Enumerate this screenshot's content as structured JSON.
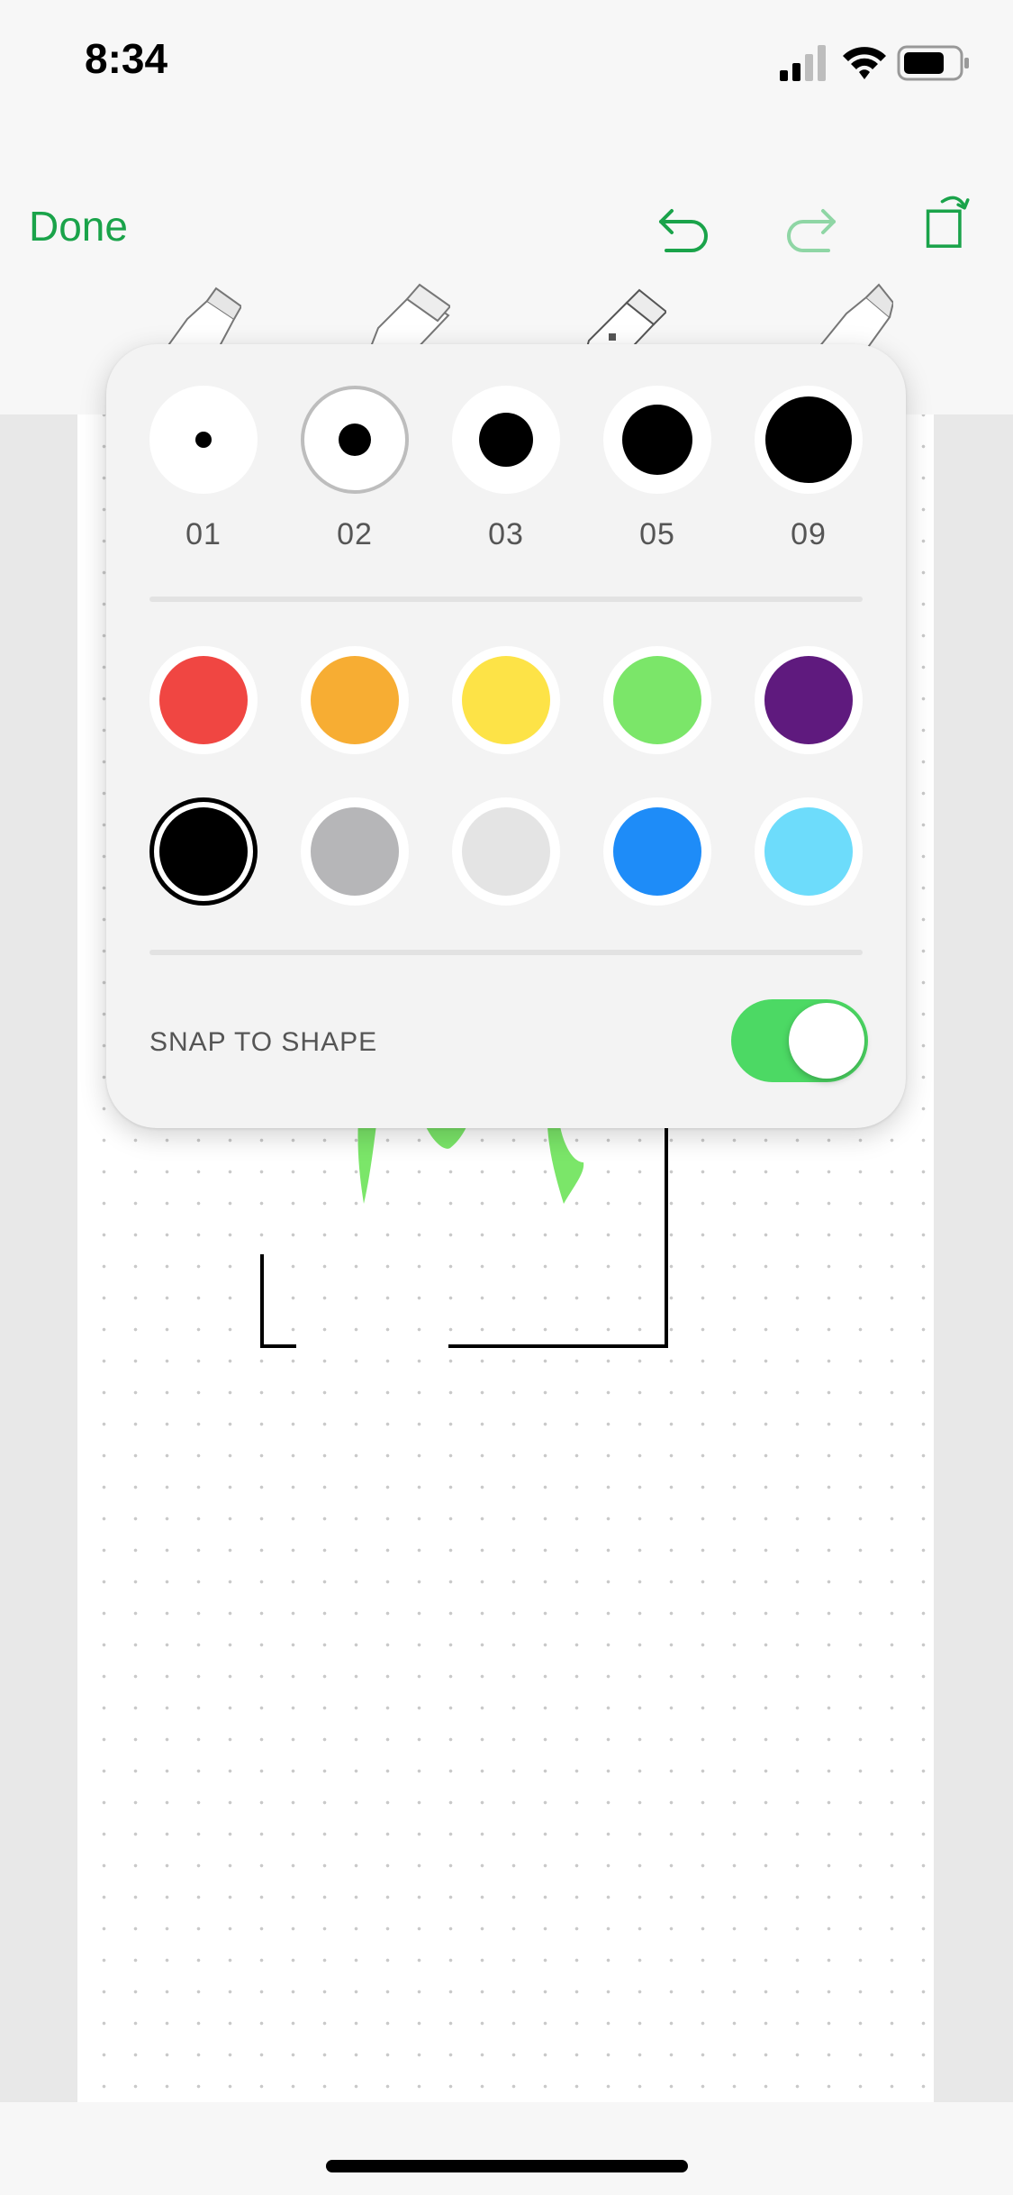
{
  "status_bar": {
    "time": "8:34",
    "icons": [
      "signal-icon",
      "wifi-icon",
      "battery-icon"
    ]
  },
  "toolbar": {
    "done_label": "Done",
    "icons": [
      "undo-icon",
      "redo-icon",
      "rotate-icon"
    ],
    "tools": [
      "pen-tool",
      "marker-tool",
      "highlighter-tool",
      "pencil-tool"
    ]
  },
  "popover": {
    "sizes": [
      {
        "label": "01",
        "selected": false
      },
      {
        "label": "02",
        "selected": true
      },
      {
        "label": "03",
        "selected": false
      },
      {
        "label": "05",
        "selected": false
      },
      {
        "label": "09",
        "selected": false
      }
    ],
    "colors": [
      {
        "name": "red",
        "hex": "#f04642",
        "selected": false
      },
      {
        "name": "orange",
        "hex": "#f7ad33",
        "selected": false
      },
      {
        "name": "yellow",
        "hex": "#fde347",
        "selected": false
      },
      {
        "name": "green",
        "hex": "#7be669",
        "selected": false
      },
      {
        "name": "purple",
        "hex": "#5f1a7e",
        "selected": false
      },
      {
        "name": "black",
        "hex": "#000000",
        "selected": true
      },
      {
        "name": "gray",
        "hex": "#b6b6b8",
        "selected": false
      },
      {
        "name": "light-gray",
        "hex": "#e4e4e4",
        "selected": false
      },
      {
        "name": "blue",
        "hex": "#1e8cf8",
        "selected": false
      },
      {
        "name": "light-blue",
        "hex": "#6ddcfb",
        "selected": false
      }
    ],
    "snap_to_shape_label": "SNAP TO SHAPE",
    "snap_to_shape_on": true
  },
  "accent_color": "#1aa34a"
}
